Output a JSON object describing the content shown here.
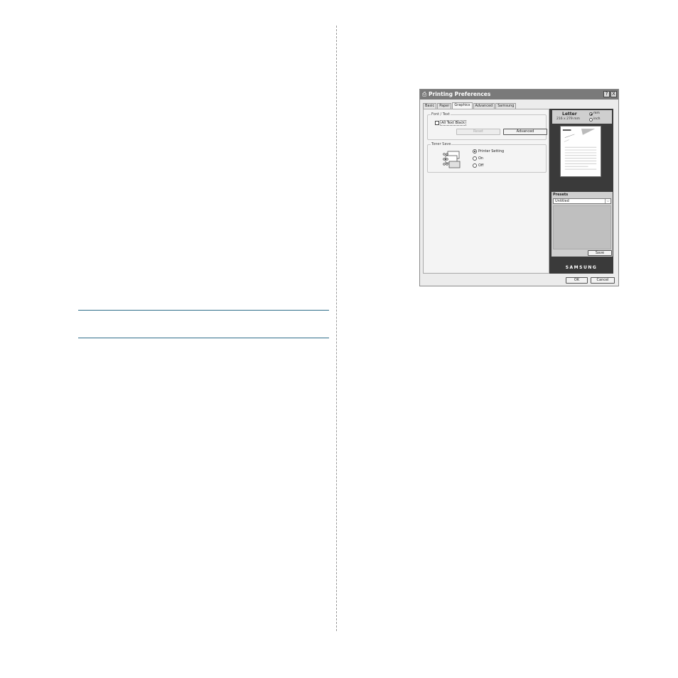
{
  "dialog": {
    "title": "Printing Preferences",
    "help_button": "?",
    "close_button": "X",
    "tabs": [
      {
        "label": "Basic"
      },
      {
        "label": "Paper"
      },
      {
        "label": "Graphics"
      },
      {
        "label": "Advanced"
      },
      {
        "label": "Samsung"
      }
    ],
    "active_tab": "Graphics"
  },
  "graphics": {
    "font_text": {
      "group_label": "Font / Text",
      "all_text_black_label": "All Text Black",
      "all_text_black_checked": false,
      "reset_label": "Reset",
      "advanced_label": "Advanced"
    },
    "toner_save": {
      "group_label": "Toner Save",
      "options": [
        {
          "label": "Printer Setting",
          "selected": true
        },
        {
          "label": "On",
          "selected": false
        },
        {
          "label": "Off",
          "selected": false
        }
      ]
    }
  },
  "side_panel": {
    "paper_name": "Letter",
    "paper_size": "216 x 279 mm",
    "units": [
      {
        "label": "mm",
        "selected": true
      },
      {
        "label": "inch",
        "selected": false
      }
    ],
    "presets_label": "Presets",
    "preset_value": "Untitled",
    "save_label": "Save",
    "brand": "SAMSUNG"
  },
  "footer": {
    "ok_label": "OK",
    "cancel_label": "Cancel"
  }
}
